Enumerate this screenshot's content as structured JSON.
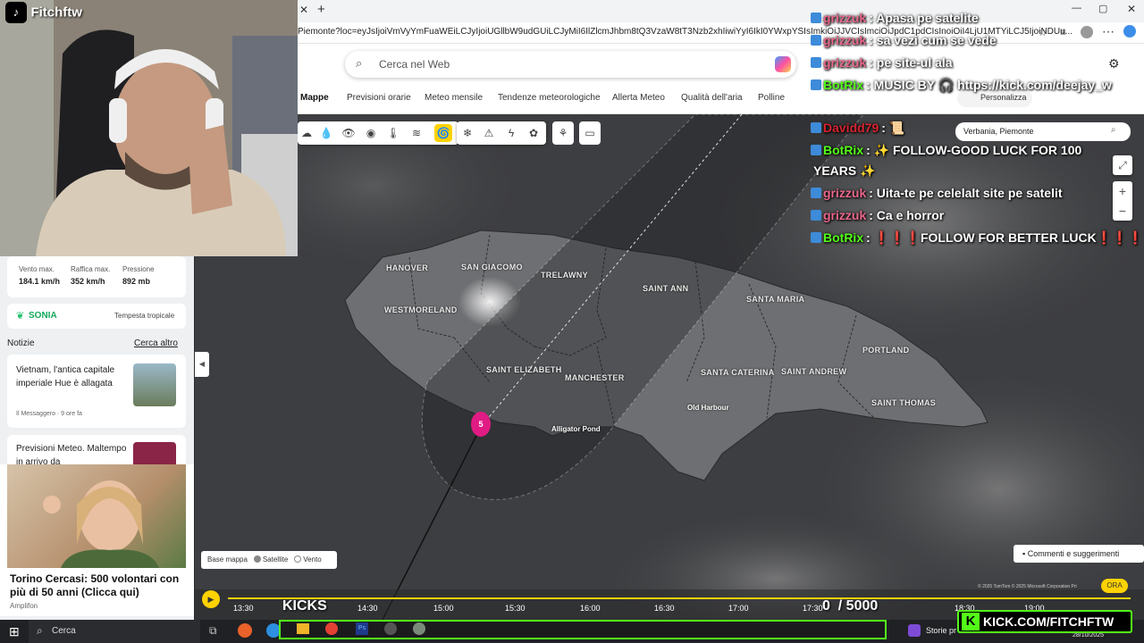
{
  "streamer": {
    "name": "Fitchftw"
  },
  "browser": {
    "url": "Piemonte?loc=eyJsIjoiVmVyYmFuaWEiLCJyIjoiUGllbW9udGUiLCJyMiI6IlZlcmJhbm8tQ3VzaW8tT3Nzb2xhIiwiYyI6IkI0YWxpYSIsImkiOiJJVCIsImciOiJpdC1pdCIsInoiOiI4LjU1MTYiLCJ5IjoiNDUu..."
  },
  "search": {
    "placeholder": "Cerca nel Web"
  },
  "nav": {
    "tabs": [
      "Mappe",
      "Previsioni orarie",
      "Meteo mensile",
      "Tendenze meteorologiche",
      "Allerta Meteo",
      "Qualità dell'aria",
      "Polline"
    ],
    "personalizza": "Personalizza",
    "location": "Verbania, Piemonte"
  },
  "map": {
    "parishes": [
      "HANOVER",
      "SAN GIACOMO",
      "TRELAWNY",
      "SAINT ANN",
      "SANTA MARIA",
      "WESTMORELAND",
      "SAINT ELIZABETH",
      "MANCHESTER",
      "PORTLAND",
      "SANTA CATERINA",
      "SAINT ANDREW",
      "SAINT THOMAS"
    ],
    "cities": [
      "Alligator Pond",
      "Old Harbour"
    ],
    "storm_category": "5",
    "base_label": "Base mappa",
    "option_satellite": "Satellite",
    "option_vento": "Vento",
    "feedback": "Commenti e suggerimenti",
    "copyright": "© 2025 TomTom  © 2025 Microsoft Corporation  Pri",
    "ora": "ORA"
  },
  "storm": {
    "wind_max_label": "Vento max.",
    "wind_max": "184.1 km/h",
    "gust_max_label": "Raffica max.",
    "gust_max": "352 km/h",
    "pressure_label": "Pressione",
    "pressure": "892 mb",
    "name": "SONIA",
    "type": "Tempesta tropicale"
  },
  "news": {
    "header": "Notizie",
    "more": "Cerca altro",
    "item1_title": "Vietnam, l'antica capitale imperiale Hue è allagata",
    "item1_source": "Il Messaggero · 9 ore fa",
    "item2_title": "Previsioni Meteo. Maltempo in arrivo da",
    "ad_title": "Torino Cercasi: 500 volontari con più di 50 anni (Clicca qui)",
    "ad_source": "Amplifon"
  },
  "timeline": {
    "ticks": [
      "13:30",
      "14:30",
      "15:00",
      "15:30",
      "16:00",
      "16:30",
      "17:00",
      "17:30",
      "18:30",
      "19:00"
    ],
    "kicks_label": "KICKS",
    "goal": "0  / 5000"
  },
  "chat": [
    {
      "user": "grizzuk",
      "msg": ": Apasa pe satelite",
      "color": "#e8668a"
    },
    {
      "user": "grizzuk",
      "msg": ": sa vezi cum se vede",
      "color": "#e8668a"
    },
    {
      "user": "grizzuk",
      "msg": ": pe site-ul ala",
      "color": "#e8668a"
    },
    {
      "user": "BotRix",
      "msg": ": MUSIC BY 🎧 https://kick.com/deejay_w",
      "color": "#53fc18"
    },
    {
      "user": "Davidd79",
      "msg": ": 📜",
      "color": "#d4242f"
    },
    {
      "user": "BotRix",
      "msg": ": ✨ FOLLOW-GOOD LUCK FOR 100",
      "color": "#53fc18"
    },
    {
      "user": "",
      "msg": "YEARS ✨",
      "color": "#ffffff"
    },
    {
      "user": "grizzuk",
      "msg": ": Uita-te pe celelalt site pe satelit",
      "color": "#e8668a"
    },
    {
      "user": "grizzuk",
      "msg": ": Ca e horror",
      "color": "#e8668a"
    },
    {
      "user": "BotRix",
      "msg": ": ❗❗❗FOLLOW FOR BETTER LUCK❗❗❗",
      "color": "#53fc18"
    }
  ],
  "kick_banner": "KICK.COM/FITCHFTW",
  "taskbar": {
    "search": "Cerca",
    "news": "Storie pr",
    "date": "28/10/2025"
  }
}
